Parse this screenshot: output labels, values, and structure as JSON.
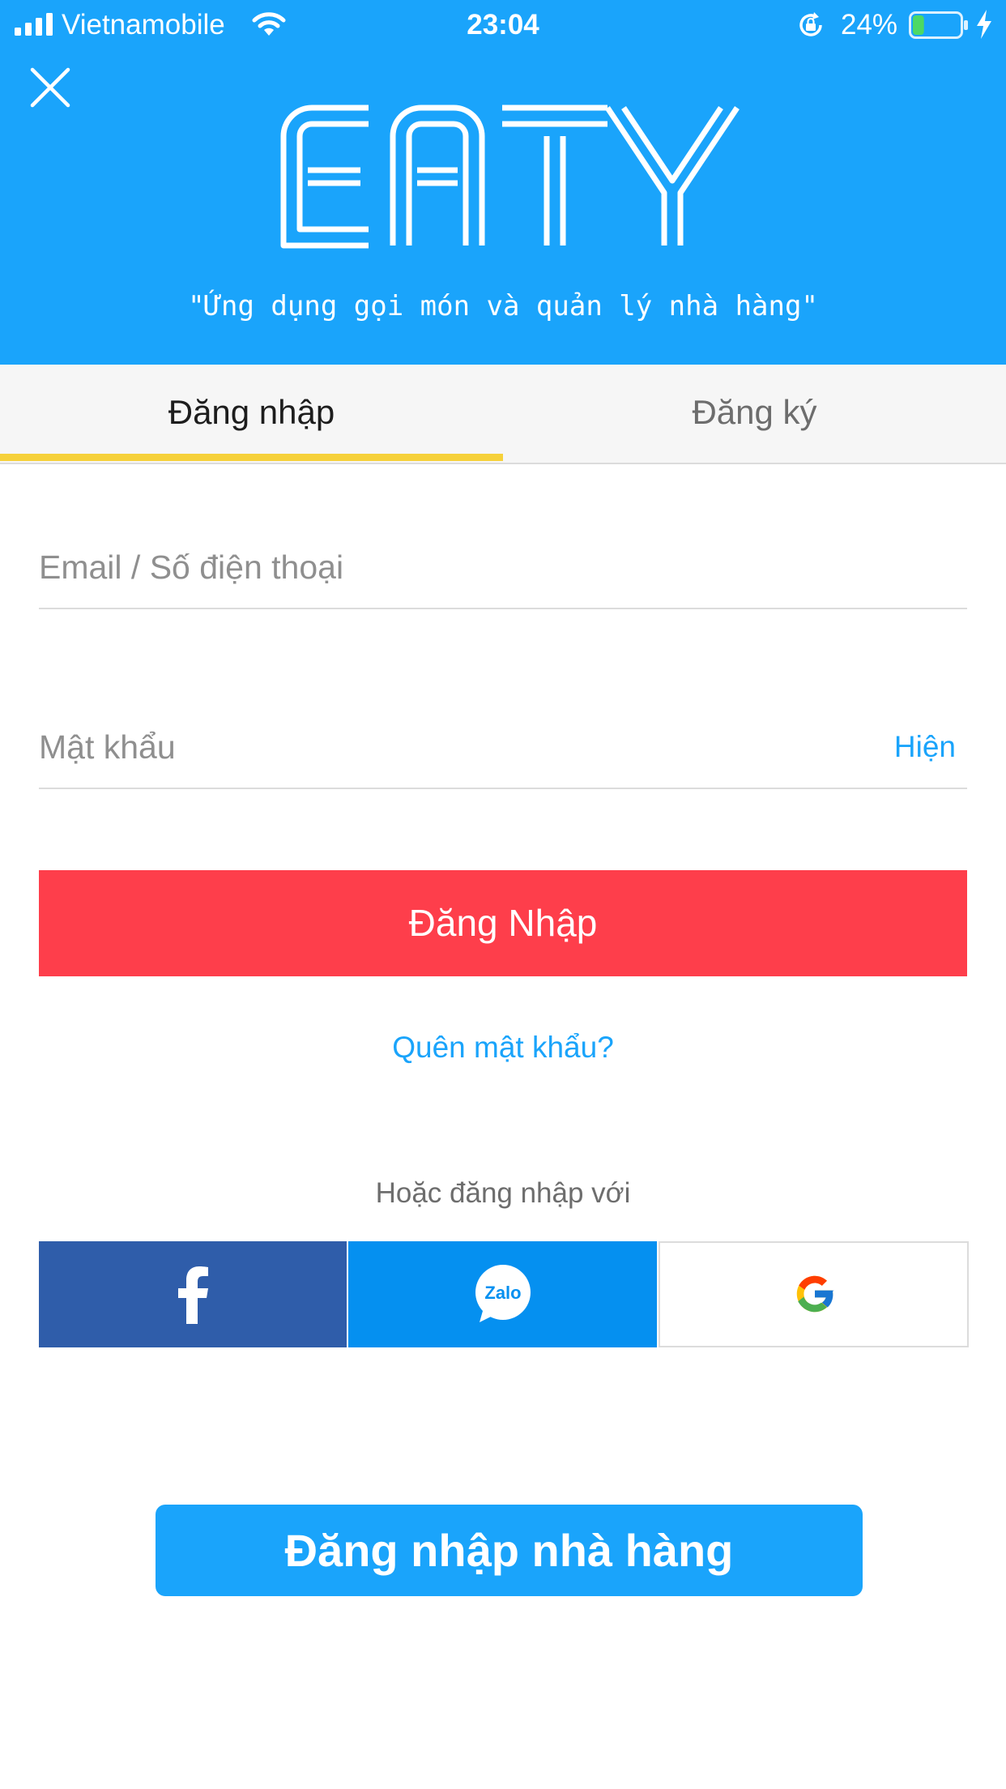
{
  "status_bar": {
    "carrier": "Vietnamobile",
    "time": "23:04",
    "battery_percent": "24%",
    "battery_level": 0.24,
    "icons": [
      "signal-icon",
      "wifi-icon",
      "rotation-lock-icon",
      "battery-icon",
      "charging-bolt-icon"
    ]
  },
  "header": {
    "logo_text": "EATY",
    "tagline": "\"Ứng dụng gọi món và quản lý nhà hàng\"",
    "close_icon": "close-icon",
    "background_color": "#1aa4fb"
  },
  "tabs": [
    {
      "label": "Đăng nhập",
      "active": true
    },
    {
      "label": "Đăng ký",
      "active": false
    }
  ],
  "form": {
    "email_placeholder": "Email / Số điện thoại",
    "password_placeholder": "Mật khẩu",
    "show_password_label": "Hiện",
    "login_button": "Đăng Nhập",
    "forgot_password": "Quên mật khẩu?"
  },
  "social": {
    "divider_text": "Hoặc đăng nhập với",
    "providers": [
      {
        "name": "facebook",
        "icon": "facebook-icon",
        "color": "#2f5daa"
      },
      {
        "name": "zalo",
        "icon": "zalo-icon",
        "icon_text": "Zalo",
        "color": "#0590f0"
      },
      {
        "name": "google",
        "icon": "google-icon",
        "color": "#ffffff"
      }
    ]
  },
  "restaurant_login_button": "Đăng nhập nhà hàng",
  "colors": {
    "primary": "#1aa4fb",
    "danger": "#fe3e4b",
    "tab_indicator": "#f6d13a"
  }
}
